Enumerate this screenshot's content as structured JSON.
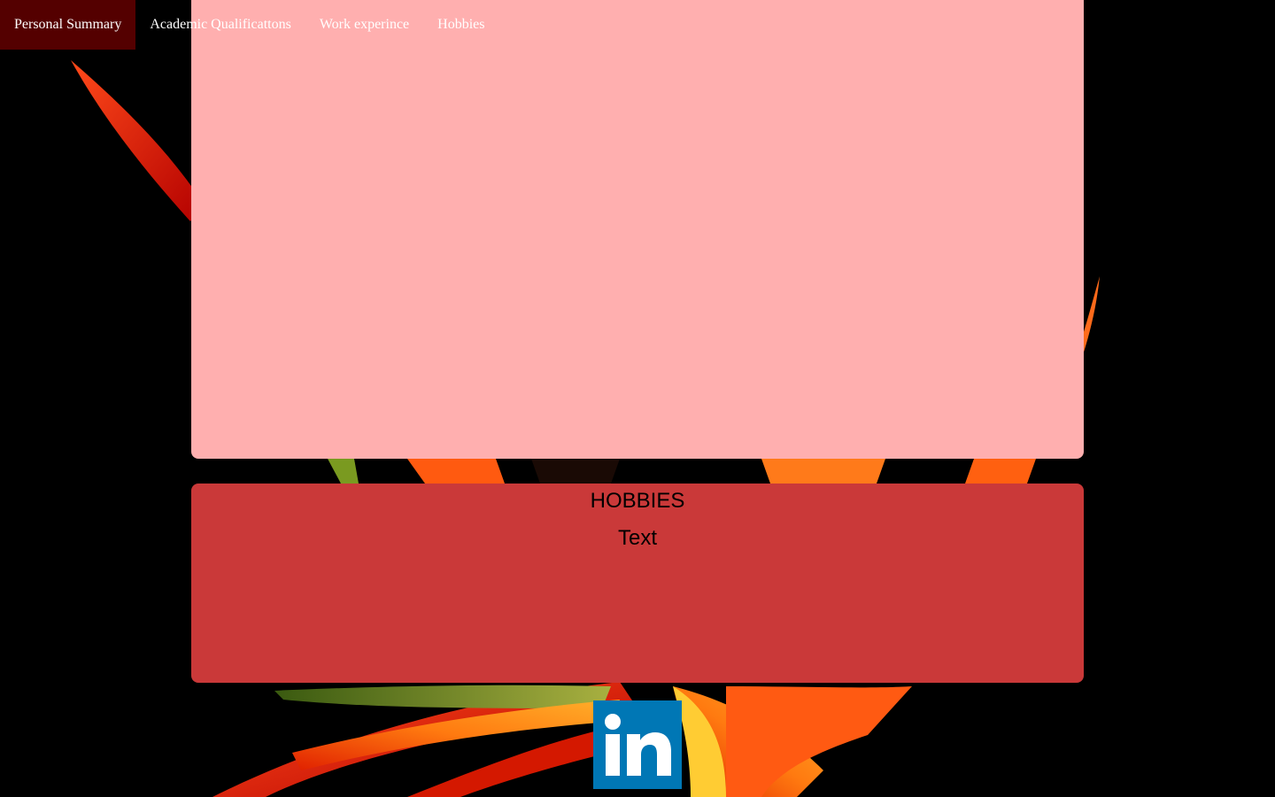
{
  "nav": {
    "items": [
      {
        "label": "Personal Summary",
        "active": true
      },
      {
        "label": "Academic Qualificattons",
        "active": false
      },
      {
        "label": "Work experince",
        "active": false
      },
      {
        "label": "Hobbies",
        "active": false
      }
    ]
  },
  "hobbies": {
    "title": "HOBBIES",
    "text": "Text"
  },
  "social": {
    "linkedin_icon": "linkedin-icon",
    "linkedin_color": "#0077b5"
  },
  "colors": {
    "nav_active": "#540000",
    "panel_top": "#ffafaf",
    "panel_hobbies": "#ca3939",
    "page_bg": "#000000"
  },
  "background_image": "bird-of-paradise flower on black"
}
